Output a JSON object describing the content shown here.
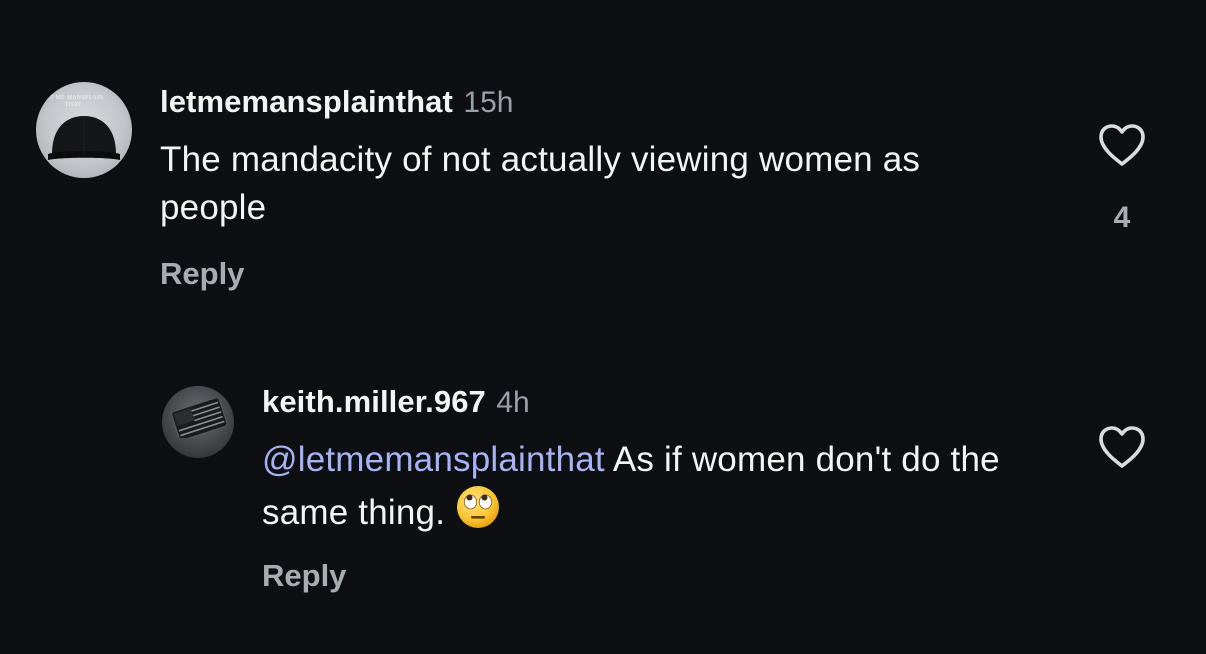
{
  "comments": [
    {
      "username": "letmemansplainthat",
      "time": "15h",
      "avatar_text": "LET ME MANSPLAIN THAT",
      "text": "The mandacity of not actually viewing women as people",
      "reply_label": "Reply",
      "likes": "4",
      "icon": "heart-outline-icon"
    },
    {
      "username": "keith.miller.967",
      "time": "4h",
      "mention": "@letmemansplainthat",
      "text": " As if women don't do the same thing.",
      "emoji": "face-with-rolling-eyes",
      "reply_label": "Reply",
      "icon": "heart-outline-icon"
    }
  ],
  "colors": {
    "background": "#0d0f13",
    "text": "#f3f4f6",
    "muted": "#9aa0a8",
    "mention": "#a7b3f5"
  }
}
